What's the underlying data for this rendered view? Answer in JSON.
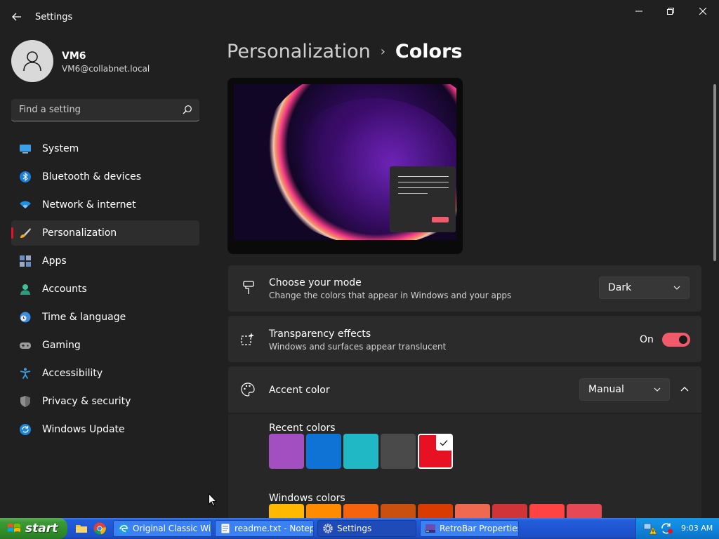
{
  "window": {
    "title": "Settings"
  },
  "user": {
    "name": "VM6",
    "email": "VM6@collabnet.local"
  },
  "search": {
    "placeholder": "Find a setting"
  },
  "nav": {
    "items": [
      {
        "label": "System"
      },
      {
        "label": "Bluetooth & devices"
      },
      {
        "label": "Network & internet"
      },
      {
        "label": "Personalization"
      },
      {
        "label": "Apps"
      },
      {
        "label": "Accounts"
      },
      {
        "label": "Time & language"
      },
      {
        "label": "Gaming"
      },
      {
        "label": "Accessibility"
      },
      {
        "label": "Privacy & security"
      },
      {
        "label": "Windows Update"
      }
    ],
    "active": "Personalization"
  },
  "header": {
    "parent": "Personalization",
    "separator": "›",
    "current": "Colors"
  },
  "mode": {
    "title": "Choose your mode",
    "subtitle": "Change the colors that appear in Windows and your apps",
    "value": "Dark"
  },
  "transparency": {
    "title": "Transparency effects",
    "subtitle": "Windows and surfaces appear translucent",
    "state": "On",
    "enabled": true
  },
  "accent": {
    "title": "Accent color",
    "value": "Manual",
    "recent_label": "Recent colors",
    "recent_colors": [
      "#a34fc1",
      "#0f73d6",
      "#1fb8c4",
      "#4a4a4a",
      "#e81123"
    ],
    "selected_color": "#e81123",
    "windows_label": "Windows colors",
    "windows_colors": [
      "#ffb900",
      "#ff8c00",
      "#f7630c",
      "#ca5010",
      "#da3b01",
      "#ef6950",
      "#d13438",
      "#ff4343",
      "#e74856"
    ]
  },
  "colors": {
    "accent": "#f05a6a",
    "background": "#202020",
    "card": "#2b2b2b"
  },
  "taskbar": {
    "start_label": "start",
    "tasks": [
      {
        "label": "Original Classic Win..."
      },
      {
        "label": "readme.txt - Notepad"
      },
      {
        "label": "Settings"
      },
      {
        "label": "RetroBar Properties"
      }
    ],
    "clock": "9:03 AM"
  }
}
